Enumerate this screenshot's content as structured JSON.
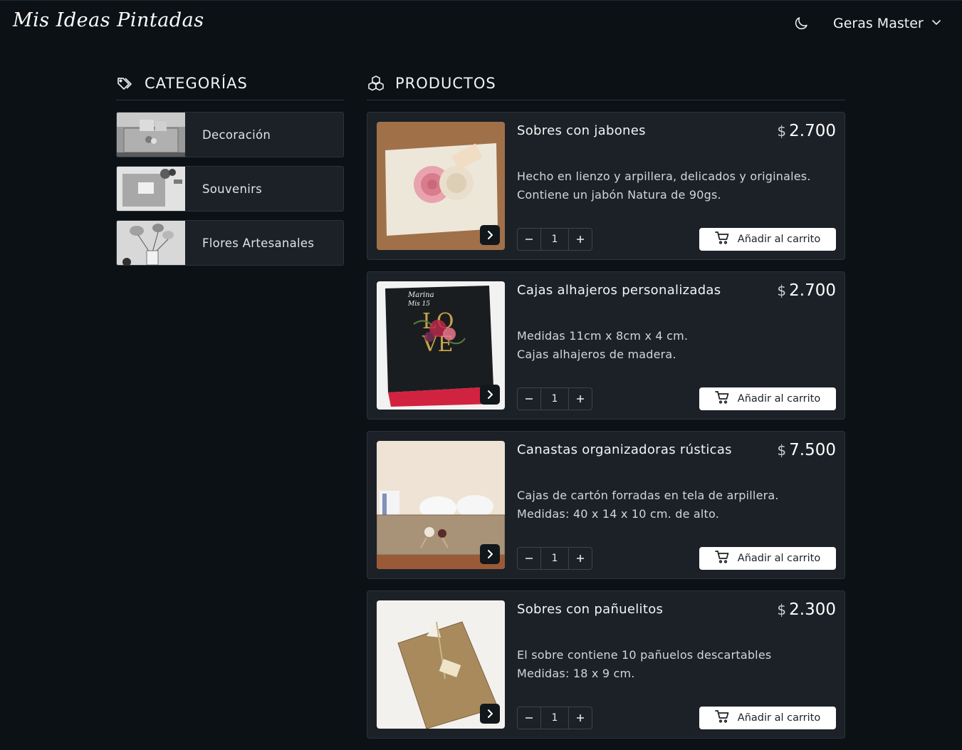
{
  "header": {
    "brand": "Mis Ideas Pintadas",
    "theme_icon": "moon-icon",
    "user_name": "Geras Master",
    "user_menu_icon": "chevron-down-icon"
  },
  "categories": {
    "title": "CATEGORÍAS",
    "icon": "tags-icon",
    "items": [
      {
        "label": "Decoración"
      },
      {
        "label": "Souvenirs"
      },
      {
        "label": "Flores Artesanales"
      }
    ]
  },
  "products": {
    "title": "PRODUCTOS",
    "icon": "cubes-icon",
    "currency_symbol": "$",
    "add_to_cart_label": "Añadir al carrito",
    "items": [
      {
        "name": "Sobres con jabones",
        "price": "2.700",
        "desc_line1": "Hecho en lienzo y arpillera, delicados y originales.",
        "desc_line2": "Contiene un jabón Natura de 90gs.",
        "quantity": "1"
      },
      {
        "name": "Cajas alhajeros personalizadas",
        "price": "2.700",
        "desc_line1": "Medidas 11cm x 8cm x 4 cm.",
        "desc_line2": "Cajas alhajeros de madera.",
        "quantity": "1",
        "image_text_1": "Marina",
        "image_text_2": "Mis 15",
        "image_text_3": "LO",
        "image_text_4": "VE"
      },
      {
        "name": "Canastas organizadoras rústicas",
        "price": "7.500",
        "desc_line1": "Cajas de cartón forradas en tela de arpillera.",
        "desc_line2": "Medidas: 40 x 14 x 10 cm. de alto.",
        "quantity": "1"
      },
      {
        "name": "Sobres con pañuelitos",
        "price": "2.300",
        "desc_line1": "El sobre contiene 10 pañuelos descartables",
        "desc_line2": "Medidas: 18 x 9 cm.",
        "quantity": "1"
      }
    ]
  },
  "colors": {
    "background": "#0b1115",
    "card": "#1b2127",
    "border": "#2b343b",
    "button_bg": "#ffffff"
  }
}
